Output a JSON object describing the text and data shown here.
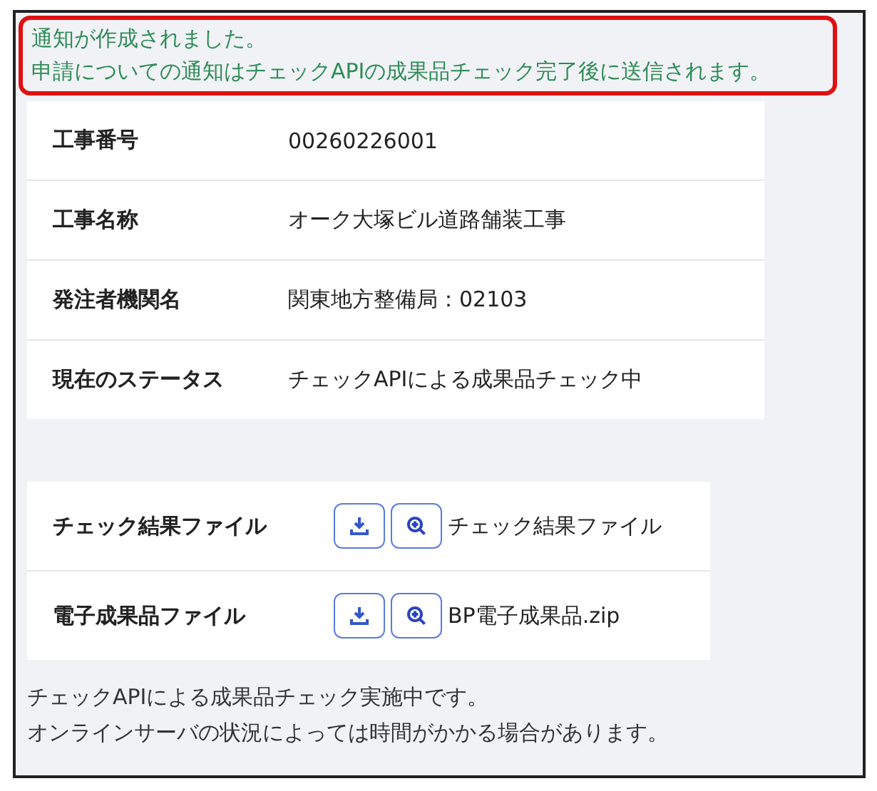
{
  "notice": {
    "lines": [
      "通知が作成されました。",
      "申請についての通知はチェックAPIの成果品チェック完了後に送信されます。"
    ]
  },
  "details": [
    {
      "label": "工事番号",
      "value": "00260226001"
    },
    {
      "label": "工事名称",
      "value": "オーク大塚ビル道路舗装工事"
    },
    {
      "label": "発注者機関名",
      "value": "関東地方整備局：02103"
    },
    {
      "label": "現在のステータス",
      "value": "チェックAPIによる成果品チェック中"
    }
  ],
  "files": [
    {
      "label": "チェック結果ファイル",
      "file_name": "チェック結果ファイル"
    },
    {
      "label": "電子成果品ファイル",
      "file_name": "BP電子成果品.zip"
    }
  ],
  "footer": [
    "チェックAPIによる成果品チェック実施中です。",
    "オンラインサーバの状況によっては時間がかかる場合があります。"
  ]
}
